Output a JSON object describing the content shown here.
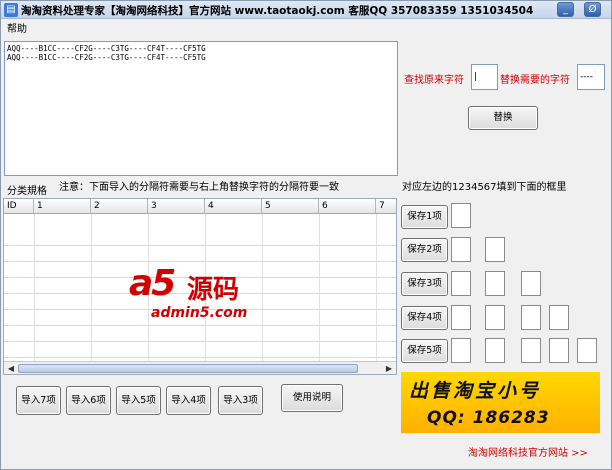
{
  "window": {
    "title": "淘淘资料处理专家【淘淘网络科技】官方网站 www.taotaokj.com 客服QQ 357083359 1351034504",
    "minimize_label": "_",
    "close_label": "Ø"
  },
  "menu": {
    "help_label": "帮助"
  },
  "input_text": "AQQ----B1CC----CF2G----C3TG----CF4T----CF5TG\nAQQ----B1CC----CF2G----C3TG----CF4T----CF5TG",
  "find_label": "查找原来字符",
  "find_value": "|",
  "replace_label": "替换需要的字符",
  "replace_value": "----",
  "replace_button": "替换",
  "category_label": "分类規格",
  "note_text": "注意：下面导入的分隔符需要与右上角替换字符的分隔符要一致",
  "fill_hint": "对应左边的1234567填到下面的框里",
  "grid_headers": [
    "ID",
    "1",
    "2",
    "3",
    "4",
    "5",
    "6",
    "7"
  ],
  "save_buttons": [
    "保存1项",
    "保存2项",
    "保存3项",
    "保存4项",
    "保存5项"
  ],
  "import_buttons": [
    "导入7项",
    "导入6项",
    "导入5项",
    "导入4项",
    "导入3项"
  ],
  "help_button": "使用说明",
  "logo": {
    "mark": "a5",
    "cn": "源码",
    "url": "admin5.com"
  },
  "banner": {
    "line1": "出售淘宝小号",
    "line2": "QQ: 186283"
  },
  "official_link": "淘淘网络科技官方网站 >>",
  "scroll_left": "◀",
  "scroll_right": "▶"
}
